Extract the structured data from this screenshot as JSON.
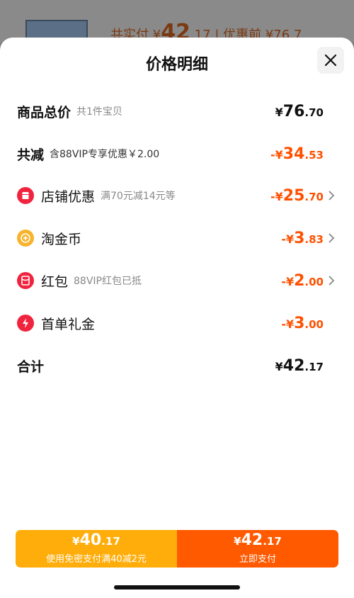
{
  "background": {
    "text_prefix": "共实付 ¥",
    "price_int": "42",
    "price_dec": ".17",
    "text_suffix": "| 优惠前 ¥76.7"
  },
  "sheet": {
    "title": "价格明细",
    "close_icon": "close-icon"
  },
  "rows": {
    "total": {
      "label": "商品总价",
      "sub": "共1件宝贝",
      "yen": "¥",
      "int": "76",
      "dec": ".70"
    },
    "discount": {
      "label": "共减",
      "sub": "含88VIP专享优惠￥2.00",
      "yen": "-¥",
      "int": "34",
      "dec": ".53"
    },
    "store": {
      "label": "店铺优惠",
      "sub": "满70元减14元等",
      "yen": "-¥",
      "int": "25",
      "dec": ".70",
      "icon": "store-icon"
    },
    "coin": {
      "label": "淘金币",
      "sub": "",
      "yen": "-¥",
      "int": "3",
      "dec": ".83",
      "icon": "coin-icon"
    },
    "redpacket": {
      "label": "红包",
      "sub": "88VIP红包已抵",
      "yen": "-¥",
      "int": "2",
      "dec": ".00",
      "icon": "red-packet-icon"
    },
    "firstorder": {
      "label": "首单礼金",
      "sub": "",
      "yen": "-¥",
      "int": "3",
      "dec": ".00",
      "icon": "lightning-icon"
    },
    "sum": {
      "label": "合计",
      "yen": "¥",
      "int": "42",
      "dec": ".17"
    }
  },
  "pay": {
    "left": {
      "yen": "¥",
      "int": "40",
      "dec": ".17",
      "label": "使用免密支付满40减2元"
    },
    "right": {
      "yen": "¥",
      "int": "42",
      "dec": ".17",
      "label": "立即支付"
    }
  },
  "colors": {
    "accent_orange": "#ff5000",
    "pay_left": "#ffad0a",
    "pay_right": "#ff5a00",
    "icon_red": "#f0243e",
    "icon_gold": "#f7b32b"
  }
}
